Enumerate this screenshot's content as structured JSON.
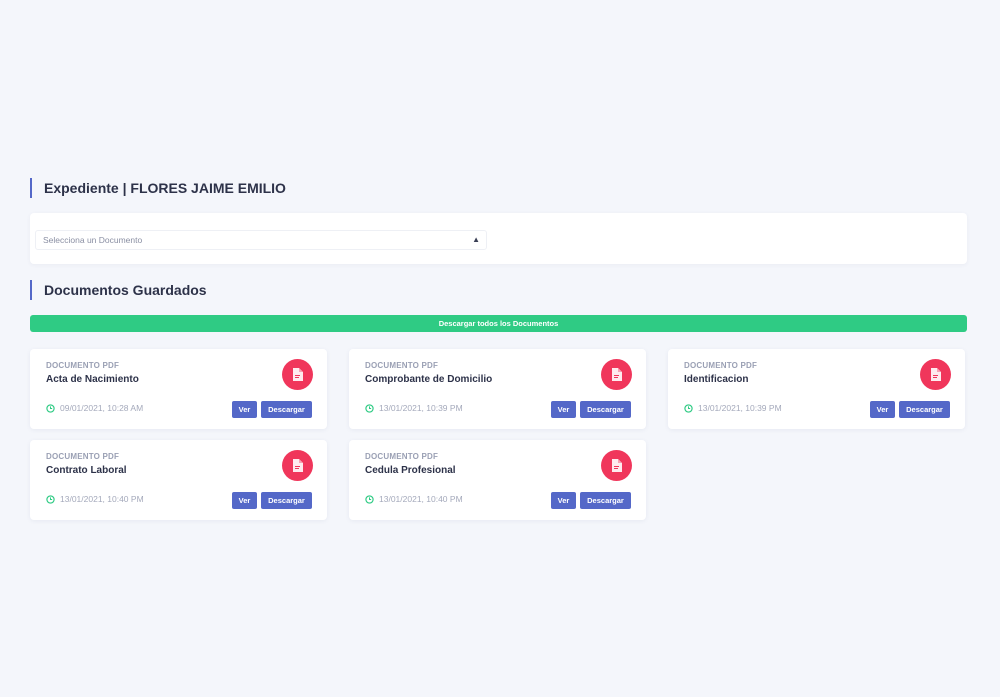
{
  "header": {
    "title": "Expediente | FLORES JAIME EMILIO"
  },
  "selector": {
    "placeholder": "Selecciona un Documento"
  },
  "saved": {
    "title": "Documentos Guardados",
    "download_all_label": "Descargar todos los Documentos"
  },
  "documents": [
    {
      "type": "DOCUMENTO PDF",
      "name": "Acta de Nacimiento",
      "date": "09/01/2021, 10:28 AM",
      "view_label": "Ver",
      "download_label": "Descargar"
    },
    {
      "type": "DOCUMENTO PDF",
      "name": "Comprobante de Domicilio",
      "date": "13/01/2021, 10:39 PM",
      "view_label": "Ver",
      "download_label": "Descargar"
    },
    {
      "type": "DOCUMENTO PDF",
      "name": "Identificacion",
      "date": "13/01/2021, 10:39 PM",
      "view_label": "Ver",
      "download_label": "Descargar"
    },
    {
      "type": "DOCUMENTO PDF",
      "name": "Contrato Laboral",
      "date": "13/01/2021, 10:40 PM",
      "view_label": "Ver",
      "download_label": "Descargar"
    },
    {
      "type": "DOCUMENTO PDF",
      "name": "Cedula Profesional",
      "date": "13/01/2021, 10:40 PM",
      "view_label": "Ver",
      "download_label": "Descargar"
    }
  ],
  "icons": {
    "document": "pdf-file-icon",
    "clock": "clock-icon",
    "select": "sort-arrows-icon"
  },
  "colors": {
    "accent": "#5468c8",
    "success": "#2fcb84",
    "danger": "#f0365b",
    "background": "#f4f6fb"
  }
}
